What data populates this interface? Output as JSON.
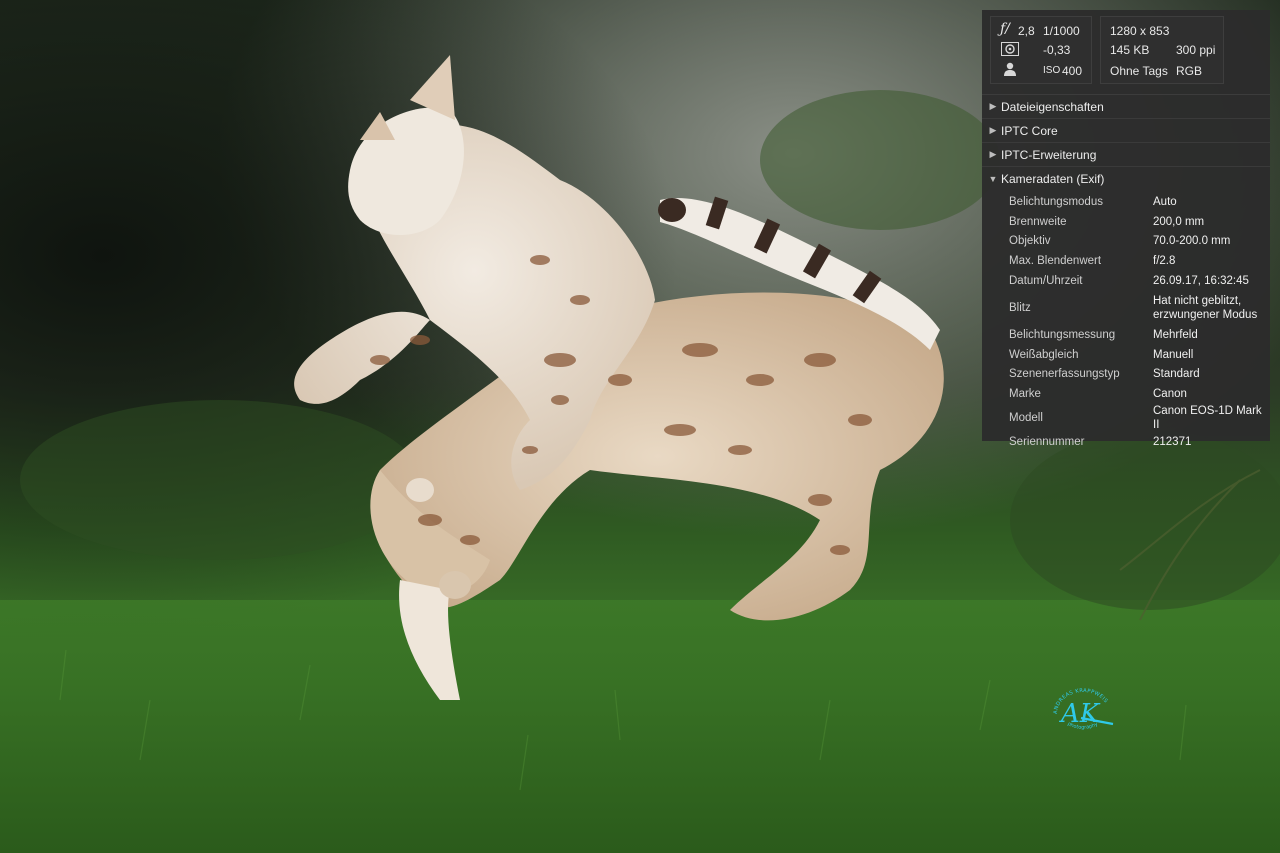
{
  "summary": {
    "aperture_prefix": "ƒ/",
    "aperture": "2,8",
    "shutter": "1/1000",
    "exposure_comp": "-0,33",
    "iso_label": "ISO",
    "iso": "400",
    "dimensions": "1280 x 853",
    "file_size": "145 KB",
    "resolution": "300 ppi",
    "tags": "Ohne Tags",
    "color_mode": "RGB"
  },
  "sections": [
    {
      "label": "Dateieigenschaften",
      "open": false
    },
    {
      "label": "IPTC Core",
      "open": false
    },
    {
      "label": "IPTC-Erweiterung",
      "open": false
    },
    {
      "label": "Kameradaten (Exif)",
      "open": true
    }
  ],
  "exif": [
    {
      "key": "Belichtungsmodus",
      "value": "Auto"
    },
    {
      "key": "Brennweite",
      "value": "200,0 mm"
    },
    {
      "key": "Objektiv",
      "value": "70.0-200.0 mm"
    },
    {
      "key": "Max. Blendenwert",
      "value": "f/2.8"
    },
    {
      "key": "Datum/Uhrzeit",
      "value": "26.09.17, 16:32:45"
    },
    {
      "key": "Blitz",
      "value": "Hat nicht geblitzt, erzwungener Modus"
    },
    {
      "key": "Belichtungsmessung",
      "value": "Mehrfeld"
    },
    {
      "key": "Weißabgleich",
      "value": "Manuell"
    },
    {
      "key": "Szenenerfassungstyp",
      "value": "Standard"
    },
    {
      "key": "Marke",
      "value": "Canon"
    },
    {
      "key": "Modell",
      "value": "Canon EOS-1D Mark II"
    },
    {
      "key": "Seriennummer",
      "value": "212371"
    }
  ],
  "watermark": {
    "initials": "AK",
    "arc_top": "ANDREAS KRAPPWEIS",
    "arc_bottom": "photography",
    "color": "#2fc9e8"
  },
  "icons": {
    "metering": "metering-mode-icon",
    "person": "exposure-program-icon"
  }
}
